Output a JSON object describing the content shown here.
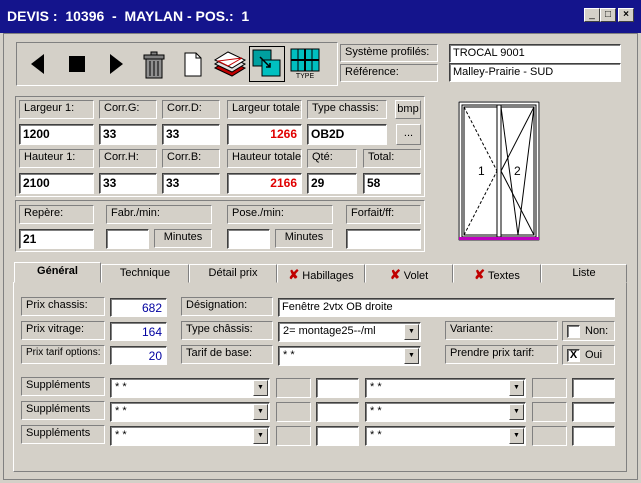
{
  "window": {
    "title": "DEVIS :  10396  -  MAYLAN - POS.:  1",
    "minimize": "_",
    "maximize": "□",
    "close": "×"
  },
  "toolbar": {
    "type_label": "TYPE"
  },
  "system": {
    "profiles_label": "Système profilés:",
    "profiles_value": "TROCAL 9001",
    "reference_label": "Référence:",
    "reference_value": "Malley-Prairie - SUD"
  },
  "dims": {
    "largeur1_label": "Largeur 1:",
    "largeur1_value": "1200",
    "corr_g_label": "Corr.G:",
    "corr_g_value": "33",
    "corr_d_label": "Corr.D:",
    "corr_d_value": "33",
    "largeur_totale_label": "Largeur totale:",
    "largeur_totale_value": "1266",
    "type_chassis_label": "Type chassis:",
    "type_chassis_value": "OB2D",
    "bmp_label": "bmp",
    "browse_label": "...",
    "hauteur1_label": "Hauteur 1:",
    "hauteur1_value": "2100",
    "corr_h_label": "Corr.H:",
    "corr_h_value": "33",
    "corr_b_label": "Corr.B:",
    "corr_b_value": "33",
    "hauteur_totale_label": "Hauteur totale:",
    "hauteur_totale_value": "2166",
    "qte_label": "Qté:",
    "qte_value": "29",
    "total_label": "Total:",
    "total_value": "58"
  },
  "times": {
    "repere_label": "Repère:",
    "repere_value": "21",
    "fabr_label": "Fabr./min:",
    "fabr_value": "",
    "fabr_unit": "Minutes",
    "pose_label": "Pose./min:",
    "pose_value": "",
    "pose_unit": "Minutes",
    "forfait_label": "Forfait/ff:",
    "forfait_value": ""
  },
  "preview": {
    "leaf1": "1",
    "leaf2": "2"
  },
  "tabs": [
    {
      "label": "Général",
      "x": false
    },
    {
      "label": "Technique",
      "x": false
    },
    {
      "label": "Détail prix",
      "x": false
    },
    {
      "label": "Habillages",
      "x": true
    },
    {
      "label": "Volet",
      "x": true
    },
    {
      "label": "Textes",
      "x": true
    },
    {
      "label": "Liste",
      "x": false
    }
  ],
  "general": {
    "prix_chassis_label": "Prix chassis:",
    "prix_chassis_value": "682",
    "prix_vitrage_label": "Prix vitrage:",
    "prix_vitrage_value": "164",
    "prix_tarif_label": "Prix tarif options:",
    "prix_tarif_value": "20",
    "designation_label": "Désignation:",
    "designation_value": "Fenêtre 2vtx OB droite",
    "type_chassis_label": "Type châssis:",
    "type_chassis_value": "2= montage25--/ml",
    "tarif_base_label": "Tarif de base:",
    "tarif_base_value": "*  *",
    "variante_label": "Variante:",
    "non_label": "Non:",
    "non_checked": "",
    "prendre_label": "Prendre prix tarif:",
    "oui_label": "Oui",
    "oui_checked": "X"
  },
  "supplements": {
    "label": "Suppléments",
    "value": "*  *",
    "rows": [
      {
        "label": "Suppléments",
        "sel1": "*  *",
        "sel2": "*  *"
      },
      {
        "label": "Suppléments",
        "sel1": "*  *",
        "sel2": "*  *"
      },
      {
        "label": "Suppléments",
        "sel1": "*  *",
        "sel2": "*  *"
      }
    ]
  },
  "dropdown_arrow": "▼"
}
